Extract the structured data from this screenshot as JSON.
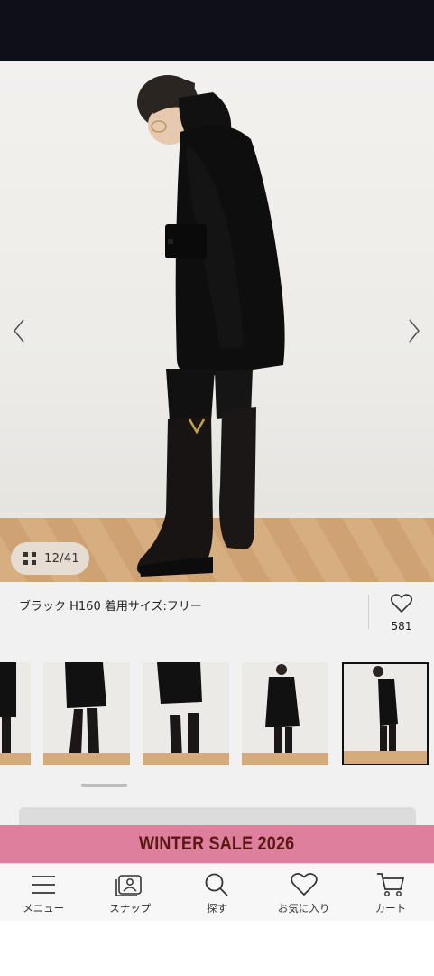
{
  "gallery": {
    "counter_text": "12/41",
    "caption": "ブラック H160 着用サイズ:フリー",
    "favorite_count": "581"
  },
  "sale_banner": {
    "text": "WINTER SALE 2026",
    "background": "#de7f9e",
    "text_color": "#5a1a12"
  },
  "bottom_nav": {
    "items": [
      {
        "label": "メニュー",
        "icon": "menu-icon"
      },
      {
        "label": "スナップ",
        "icon": "snap-icon"
      },
      {
        "label": "探す",
        "icon": "search-icon"
      },
      {
        "label": "お気に入り",
        "icon": "heart-icon"
      },
      {
        "label": "カート",
        "icon": "cart-icon"
      }
    ]
  }
}
